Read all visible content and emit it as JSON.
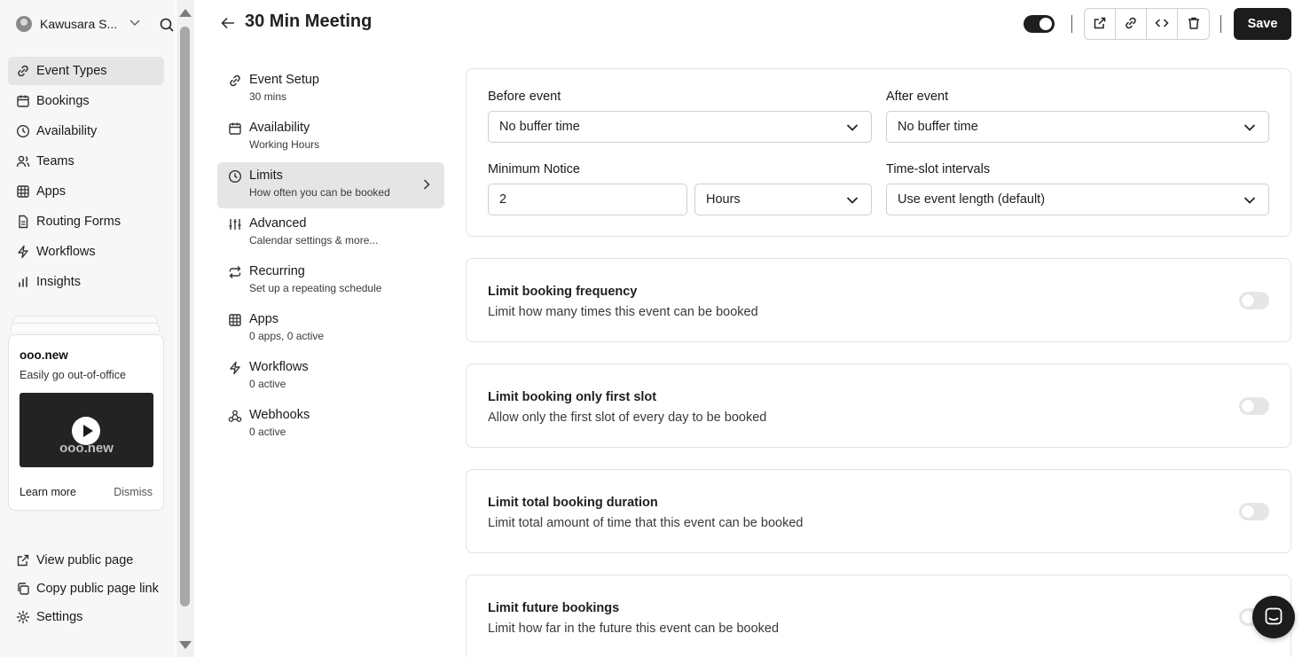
{
  "user": {
    "name": "Kawusara S..."
  },
  "sidebar": {
    "items": [
      {
        "label": "Event Types",
        "icon": "link-icon",
        "active": true
      },
      {
        "label": "Bookings",
        "icon": "calendar-icon"
      },
      {
        "label": "Availability",
        "icon": "clock-icon"
      },
      {
        "label": "Teams",
        "icon": "users-icon"
      },
      {
        "label": "Apps",
        "icon": "grid-icon"
      },
      {
        "label": "Routing Forms",
        "icon": "document-icon"
      },
      {
        "label": "Workflows",
        "icon": "zap-icon"
      },
      {
        "label": "Insights",
        "icon": "bar-chart-icon"
      }
    ],
    "promo": {
      "title": "ooo.new",
      "subtitle": "Easily go out-of-office",
      "video_logo": "ooo.new",
      "learn_more": "Learn more",
      "dismiss": "Dismiss"
    },
    "bottom": {
      "view_public": "View public page",
      "copy_link": "Copy public page link",
      "settings": "Settings"
    }
  },
  "header": {
    "title": "30 Min Meeting",
    "save_label": "Save"
  },
  "settings_nav": {
    "items": [
      {
        "label": "Event Setup",
        "sub": "30 mins",
        "icon": "link-icon"
      },
      {
        "label": "Availability",
        "sub": "Working Hours",
        "icon": "calendar-icon"
      },
      {
        "label": "Limits",
        "sub": "How often you can be booked",
        "icon": "clock-icon",
        "active": true
      },
      {
        "label": "Advanced",
        "sub": "Calendar settings & more...",
        "icon": "sliders-icon"
      },
      {
        "label": "Recurring",
        "sub": "Set up a repeating schedule",
        "icon": "repeat-icon"
      },
      {
        "label": "Apps",
        "sub": "0 apps, 0 active",
        "icon": "grid-icon"
      },
      {
        "label": "Workflows",
        "sub": "0 active",
        "icon": "zap-icon"
      },
      {
        "label": "Webhooks",
        "sub": "0 active",
        "icon": "webhook-icon"
      }
    ]
  },
  "buffer": {
    "before_label": "Before event",
    "before_value": "No buffer time",
    "after_label": "After event",
    "after_value": "No buffer time",
    "min_notice_label": "Minimum Notice",
    "min_notice_value": "2",
    "min_notice_unit": "Hours",
    "interval_label": "Time-slot intervals",
    "interval_value": "Use event length (default)"
  },
  "limits": [
    {
      "title": "Limit booking frequency",
      "desc": "Limit how many times this event can be booked",
      "enabled": false
    },
    {
      "title": "Limit booking only first slot",
      "desc": "Allow only the first slot of every day to be booked",
      "enabled": false
    },
    {
      "title": "Limit total booking duration",
      "desc": "Limit total amount of time that this event can be booked",
      "enabled": false
    },
    {
      "title": "Limit future bookings",
      "desc": "Limit how far in the future this event can be booked",
      "enabled": false
    }
  ]
}
